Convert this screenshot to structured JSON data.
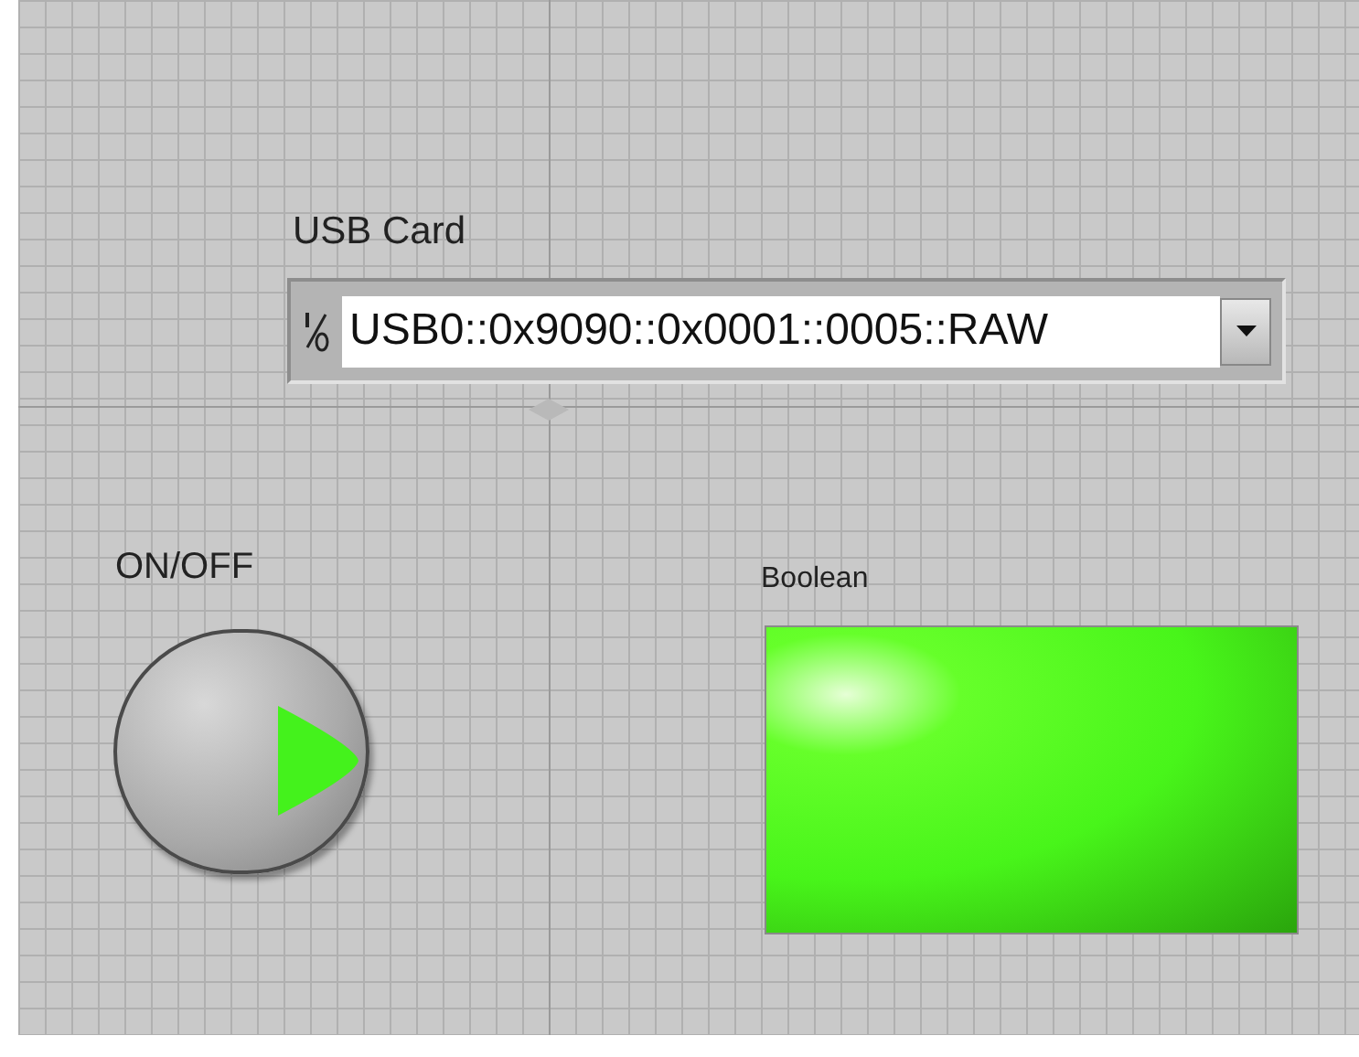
{
  "panel": {
    "usb_card": {
      "label": "USB Card",
      "value": "USB0::0x9090::0x0001::0005::RAW"
    },
    "switch": {
      "label": "ON/OFF",
      "on": true
    },
    "indicator": {
      "label": "Boolean",
      "on": true
    }
  }
}
